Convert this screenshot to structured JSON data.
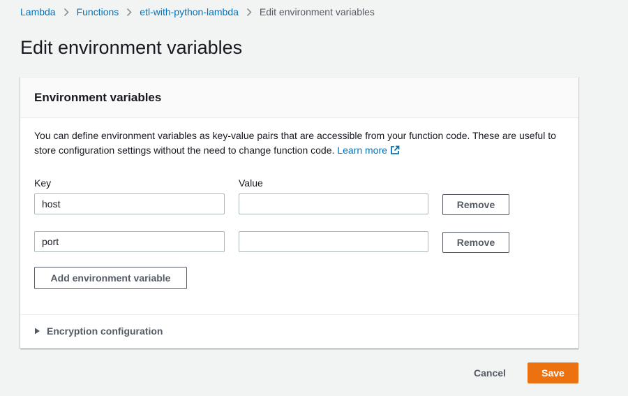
{
  "breadcrumb": {
    "items": [
      "Lambda",
      "Functions",
      "etl-with-python-lambda"
    ],
    "current": "Edit environment variables"
  },
  "page": {
    "title": "Edit environment variables"
  },
  "panel": {
    "title": "Environment variables",
    "description": "You can define environment variables as key-value pairs that are accessible from your function code. These are useful to store configuration settings without the need to change function code.",
    "learn_more": "Learn more",
    "key_label": "Key",
    "value_label": "Value",
    "variables": [
      {
        "key": "host",
        "value": ""
      },
      {
        "key": "port",
        "value": ""
      }
    ],
    "remove_label": "Remove",
    "add_label": "Add environment variable",
    "encryption_label": "Encryption configuration"
  },
  "footer": {
    "cancel_label": "Cancel",
    "save_label": "Save"
  },
  "colors": {
    "link": "#0073bb",
    "primary": "#ec7211",
    "background": "#f2f3f3"
  },
  "icons": {
    "separator": "chevron-right-icon",
    "external": "external-link-icon",
    "expand": "caret-right-icon"
  }
}
